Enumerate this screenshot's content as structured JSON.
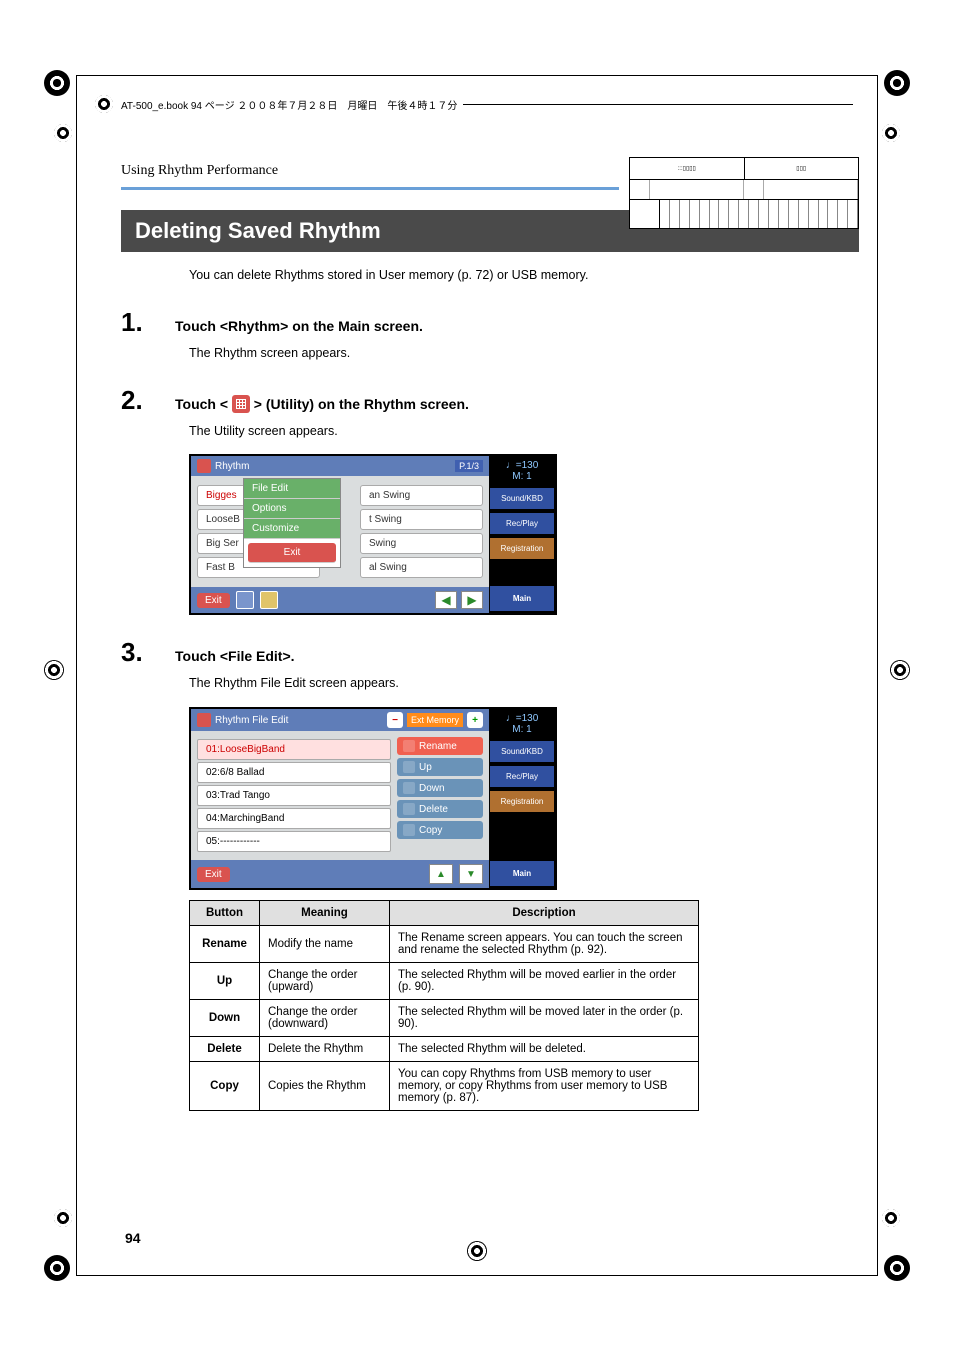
{
  "header": {
    "crop_text": "AT-500_e.book  94 ページ  ２００８年７月２８日　月曜日　午後４時１７分"
  },
  "section_title": "Using Rhythm Performance",
  "main_heading": "Deleting Saved Rhythm",
  "intro": "You can delete Rhythms stored in User memory (p. 72) or USB memory.",
  "steps": {
    "s1": {
      "num": "1.",
      "title": "Touch <Rhythm> on the Main screen.",
      "after": "The Rhythm screen appears."
    },
    "s2": {
      "num": "2.",
      "title_pre": "Touch < ",
      "title_post": " > (Utility) on the Rhythm screen.",
      "after": "The Utility screen appears."
    },
    "s3": {
      "num": "3.",
      "title": "Touch <File Edit>.",
      "after": "The Rhythm File Edit screen appears."
    }
  },
  "screenshot1": {
    "title": "Rhythm",
    "page": "P.1/3",
    "tempo": "♩=130",
    "meas": "M:    1",
    "left_items": [
      "Bigges",
      "LooseB",
      "Big Ser",
      "Fast B"
    ],
    "right_items": [
      "an Swing",
      "t Swing",
      "Swing",
      "al Swing"
    ],
    "menu": [
      "File Edit",
      "Options",
      "Customize",
      "Exit"
    ],
    "exit": "Exit",
    "side": [
      "Sound/KBD",
      "Rec/Play",
      "Registration",
      "Main"
    ]
  },
  "screenshot2": {
    "title": "Rhythm File Edit",
    "mem": "Ext Memory",
    "tempo": "♩=130",
    "meas": "M:    1",
    "rows": [
      "01:LooseBigBand",
      "02:6/8 Ballad",
      "03:Trad Tango",
      "04:MarchingBand",
      "05:------------"
    ],
    "buttons": [
      "Rename",
      "Up",
      "Down",
      "Delete",
      "Copy"
    ],
    "exit": "Exit",
    "side": [
      "Sound/KBD",
      "Rec/Play",
      "Registration",
      "Main"
    ]
  },
  "table": {
    "headers": [
      "Button",
      "Meaning",
      "Description"
    ],
    "rows": [
      {
        "b": "Rename",
        "m": "Modify the name",
        "d": "The Rename screen appears. You can touch the screen and rename the selected Rhythm (p. 92)."
      },
      {
        "b": "Up",
        "m": "Change the order (upward)",
        "d": "The selected Rhythm will be moved earlier in the order (p. 90)."
      },
      {
        "b": "Down",
        "m": "Change the order (downward)",
        "d": "The selected Rhythm will be moved later in the order (p. 90)."
      },
      {
        "b": "Delete",
        "m": "Delete the Rhythm",
        "d": "The selected Rhythm will be deleted."
      },
      {
        "b": "Copy",
        "m": "Copies the Rhythm",
        "d": "You can copy Rhythms from USB memory to user memory, or copy Rhythms from user memory to USB memory (p. 87)."
      }
    ]
  },
  "page_number": "94"
}
